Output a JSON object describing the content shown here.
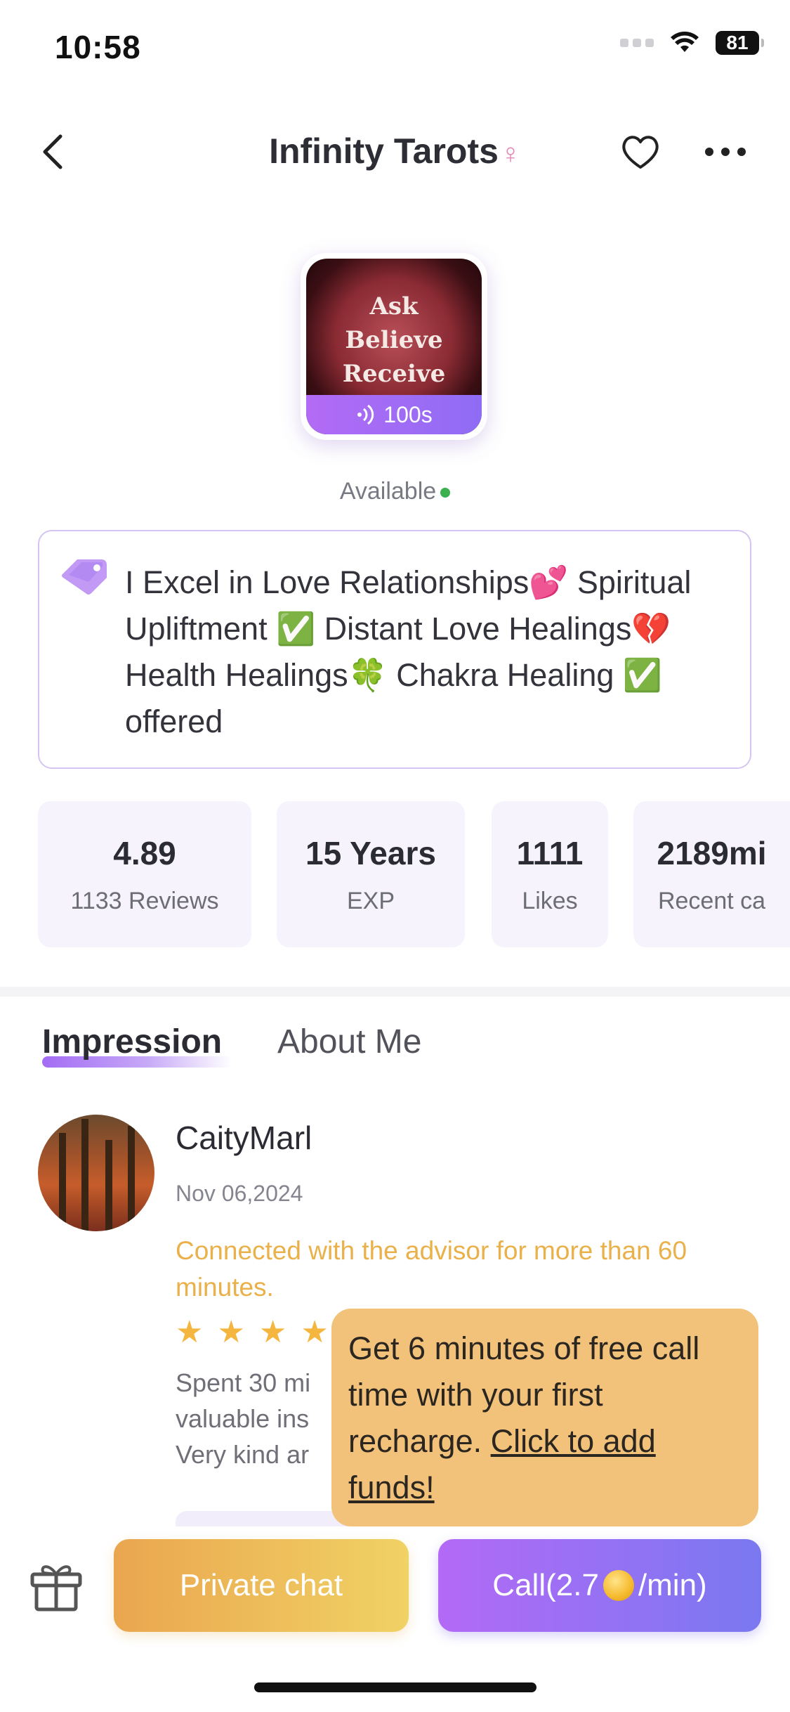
{
  "status": {
    "time": "10:58",
    "battery": "81"
  },
  "nav": {
    "title": "Infinity Tarots",
    "gender_symbol": "♀"
  },
  "avatar": {
    "image_text_lines": [
      "Ask",
      "Believe",
      "Receive"
    ],
    "audio_length": "100s"
  },
  "availability": "Available",
  "tagline": "I Excel in Love Relationships💕 Spiritual Upliftment ✅ Distant Love Healings💔 Health Healings🍀 Chakra Healing ✅ offered",
  "stats": [
    {
      "value": "4.89",
      "label": "1133 Reviews"
    },
    {
      "value": "15 Years",
      "label": "EXP"
    },
    {
      "value": "1111",
      "label": "Likes"
    },
    {
      "value": "2189mi",
      "label": "Recent ca"
    }
  ],
  "tabs": [
    {
      "label": "Impression",
      "active": true
    },
    {
      "label": "About Me",
      "active": false
    }
  ],
  "review": {
    "name": "CaityMarl",
    "date": "Nov 06,2024",
    "connected_note": "Connected with the advisor for more than 60 minutes.",
    "stars_visible": 4,
    "text_lines": [
      "Spent 30 mi",
      "valuable ins",
      "Very kind ar"
    ]
  },
  "promo": {
    "text": "Get 6 minutes of free call time with your first recharge.",
    "link": "Click to add funds!"
  },
  "actions": {
    "private_chat": "Private chat",
    "call_prefix": "Call(2.7",
    "call_suffix": "/min)"
  },
  "colors": {
    "accent_purple": "#a36cf4",
    "available_green": "#3bb04f",
    "connected_orange": "#eab04a",
    "star": "#f4b63f",
    "promo_bg": "#f2c27b"
  }
}
